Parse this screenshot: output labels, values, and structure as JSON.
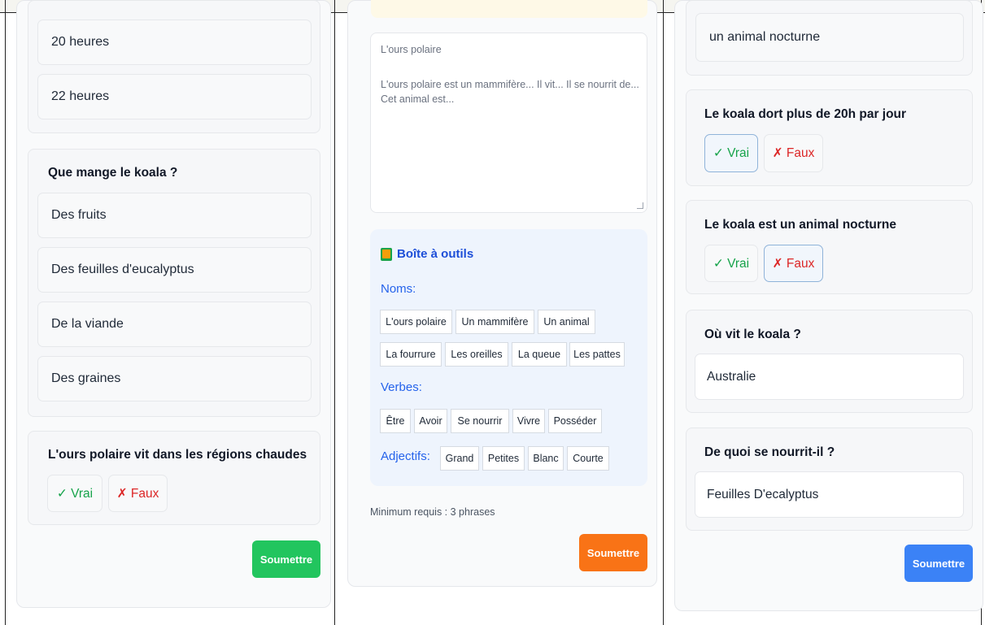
{
  "panel1": {
    "options_top": [
      "20 heures",
      "22 heures"
    ],
    "question2": {
      "title": "Que mange le koala ?",
      "options": [
        "Des fruits",
        "Des feuilles d'eucalyptus",
        "De la viande",
        "Des graines"
      ]
    },
    "question3": {
      "title": "L'ours polaire vit dans les régions chaudes",
      "vrai": "✓ Vrai",
      "faux": "✗ Faux"
    },
    "submit": "Soumettre"
  },
  "panel2": {
    "textarea": {
      "title_placeholder": "L'ours polaire",
      "line1": "L'ours polaire est un mammifère... Il vit... Il se nourrit de...",
      "line2": "Cet animal est..."
    },
    "toolbox": {
      "title": "Boîte à outils",
      "nouns_label": "Noms:",
      "nouns": [
        "L'ours polaire",
        "Un mammifère",
        "Un animal",
        "La fourrure",
        "Les oreilles",
        "La queue",
        "Les pattes"
      ],
      "verbs_label": "Verbes:",
      "verbs": [
        "Être",
        "Avoir",
        "Se nourrir",
        "Vivre",
        "Posséder"
      ],
      "adjectives_label": "Adjectifs:",
      "adjectives": [
        "Grand",
        "Petites",
        "Blanc",
        "Courte"
      ]
    },
    "min_required": "Minimum requis : 3 phrases",
    "submit": "Soumettre"
  },
  "panel3": {
    "option_top": "un animal nocturne",
    "q1": {
      "title": "Le koala dort plus de 20h par jour",
      "vrai": "✓ Vrai",
      "faux": "✗ Faux",
      "selected": "vrai"
    },
    "q2": {
      "title": "Le koala est un animal nocturne",
      "vrai": "✓ Vrai",
      "faux": "✗ Faux",
      "selected": "faux"
    },
    "q3": {
      "title": "Où vit le koala ?",
      "answer": "Australie"
    },
    "q4": {
      "title": "De quoi se nourrit-il ?",
      "answer": "Feuilles D'ecalyptus"
    },
    "submit": "Soumettre"
  },
  "colors": {
    "green": "#22c55e",
    "orange": "#f97316",
    "blue": "#3b82f6",
    "true_text": "#16a34a",
    "false_text": "#dc2626"
  }
}
